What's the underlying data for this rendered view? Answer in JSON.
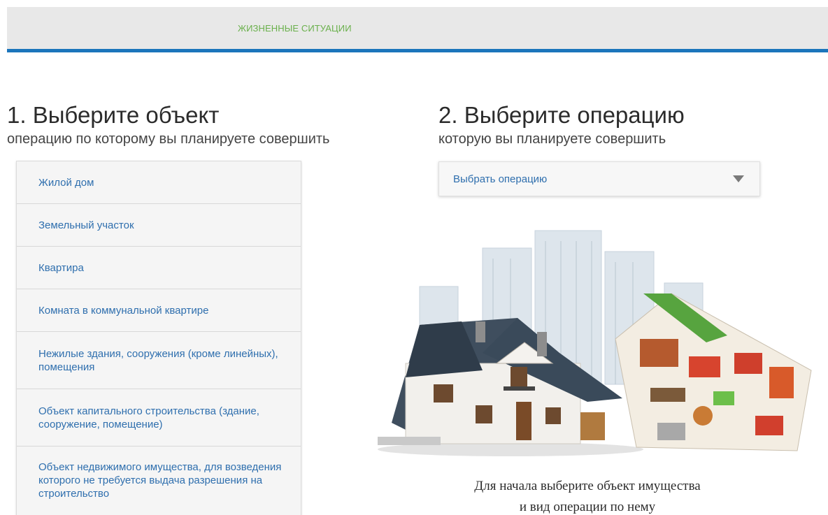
{
  "header": {
    "nav_link": "ЖИЗНЕННЫЕ СИТУАЦИИ",
    "accent_color": "#1b75bb",
    "link_color": "#6ab04c"
  },
  "step1": {
    "title": "1. Выберите объект",
    "subtitle": "операцию по которому вы планируете совершить",
    "items": [
      "Жилой дом",
      "Земельный участок",
      "Квартира",
      "Комната в коммунальной квартире",
      "Нежилые здания, сооружения (кроме линейных), помещения",
      "Объект капитального строительства (здание, сооружение, помещение)",
      "Объект недвижимого имущества, для возведения которого не требуется выдача разрешения на строительство"
    ]
  },
  "step2": {
    "title": "2. Выберите операцию",
    "subtitle": "которую вы планируете совершить",
    "select_value": "Выбрать операцию"
  },
  "hint": {
    "line1": "Для начала выберите объект имущества",
    "line2": "и вид операции по нему"
  }
}
